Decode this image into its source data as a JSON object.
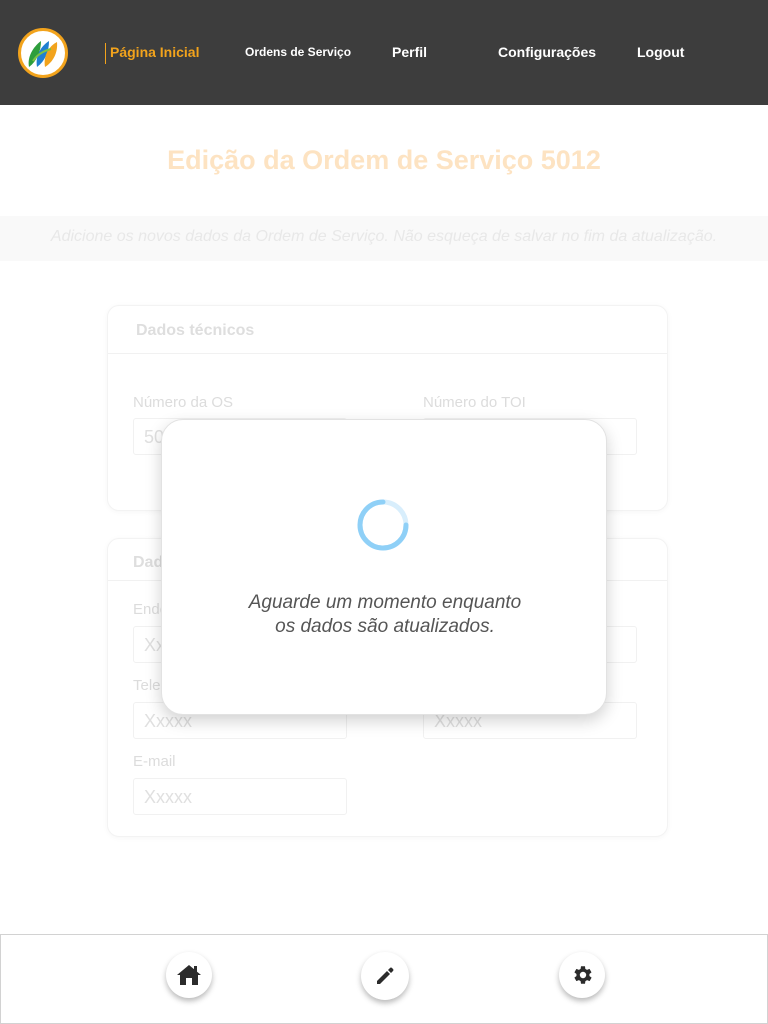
{
  "nav": {
    "home": "Página Inicial",
    "service_orders": "Ordens de Serviço",
    "profile": "Perfil",
    "settings": "Configurações",
    "logout": "Logout"
  },
  "page": {
    "title": "Edição da Ordem de Serviço 5012",
    "subtitle": "Adicione os novos dados da Ordem de Serviço. Não esqueça de salvar no fim da atualização."
  },
  "technical_card": {
    "title": "Dados técnicos",
    "os_number_label": "Número da OS",
    "os_number_value": "50",
    "toi_number_label": "Número do TOI"
  },
  "client_card": {
    "title": "Dado",
    "address_label": "Ende",
    "address_value": "Xx",
    "phone_label": "Tele",
    "phone_value": "Xxxxx",
    "phone2_value": "Xxxxx",
    "email_label": "E-mail",
    "email_value": "Xxxxx"
  },
  "modal": {
    "line1": "Aguarde um momento enquanto",
    "line2": "os dados são atualizados."
  },
  "colors": {
    "header_bg": "#3d3d3d",
    "accent": "#f2a31c",
    "spinner": "#8fd0f7"
  },
  "bottom_nav": {
    "icons": [
      "home-icon",
      "pencil-icon",
      "gear-icon"
    ]
  }
}
